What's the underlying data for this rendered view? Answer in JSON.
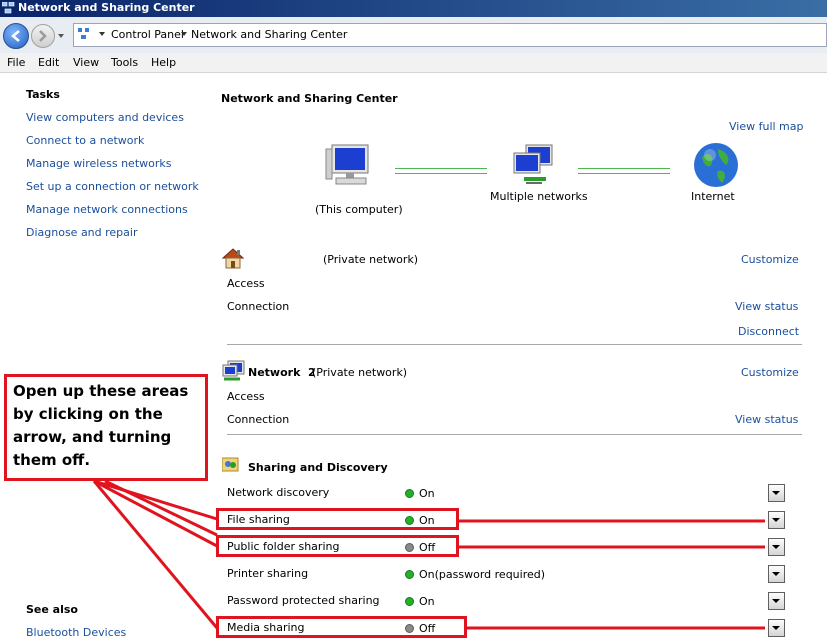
{
  "window": {
    "title": "Network and Sharing Center"
  },
  "address": {
    "crumb1": "Control Panel",
    "crumb2": "Network and Sharing Center"
  },
  "menu": [
    "File",
    "Edit",
    "View",
    "Tools",
    "Help"
  ],
  "tasks": {
    "heading": "Tasks",
    "items": [
      "View computers and devices",
      "Connect to a network",
      "Manage wireless networks",
      "Set up a connection or network",
      "Manage network connections",
      "Diagnose and repair"
    ]
  },
  "see_also": {
    "heading": "See also",
    "items": [
      "Bluetooth Devices"
    ]
  },
  "main": {
    "title": "Network and Sharing Center",
    "view_full_map": "View full map",
    "map": {
      "computer": "(This computer)",
      "networks": "Multiple networks",
      "internet": "Internet"
    },
    "network1": {
      "type": "(Private network)",
      "customize": "Customize",
      "access": "Access",
      "connection": "Connection",
      "view_status": "View status",
      "disconnect": "Disconnect"
    },
    "network2": {
      "name": "Network  2",
      "type": "(Private network)",
      "customize": "Customize",
      "access": "Access",
      "connection": "Connection",
      "view_status": "View status"
    },
    "sharing": {
      "heading": "Sharing and Discovery",
      "rows": [
        {
          "label": "Network discovery",
          "status": "On"
        },
        {
          "label": "File sharing",
          "status": "On"
        },
        {
          "label": "Public folder sharing",
          "status": "Off"
        },
        {
          "label": "Printer sharing",
          "status": "On(password required)"
        },
        {
          "label": "Password protected sharing",
          "status": "On"
        },
        {
          "label": "Media sharing",
          "status": "Off"
        }
      ]
    }
  },
  "annotation": {
    "note": "Open up these areas by clicking on the arrow, and turning them off."
  },
  "colors": {
    "link": "#1a4f9c",
    "annotation": "#e0141f",
    "on": "#23b02a",
    "off": "#8a8a8a"
  }
}
